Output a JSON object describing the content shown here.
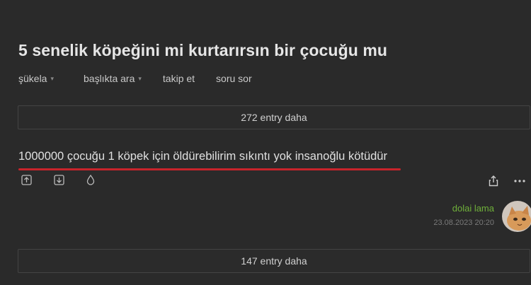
{
  "topic": {
    "title": "5 senelik köpeğini mi kurtarırsın bir çocuğu mu"
  },
  "toolbar": {
    "items": [
      {
        "label": "şükela",
        "has_dropdown": true
      },
      {
        "label": "başlıkta ara",
        "has_dropdown": true
      },
      {
        "label": "takip et",
        "has_dropdown": false
      },
      {
        "label": "soru sor",
        "has_dropdown": false
      }
    ]
  },
  "more_top": {
    "label": "272 entry daha"
  },
  "entry": {
    "text": "1000000 çocuğu 1 köpek için öldürebilirim sıkıntı yok insanoğlu kötüdür",
    "highlight_color": "#c8242b",
    "actions": [
      "upvote-icon",
      "downvote-icon",
      "drop-icon"
    ],
    "right_actions": [
      "share-icon",
      "more-icon"
    ],
    "author": "dolai lama",
    "author_color": "#6fb03a",
    "date": "23.08.2023 20:20"
  },
  "more_bottom": {
    "label": "147 entry daha"
  }
}
